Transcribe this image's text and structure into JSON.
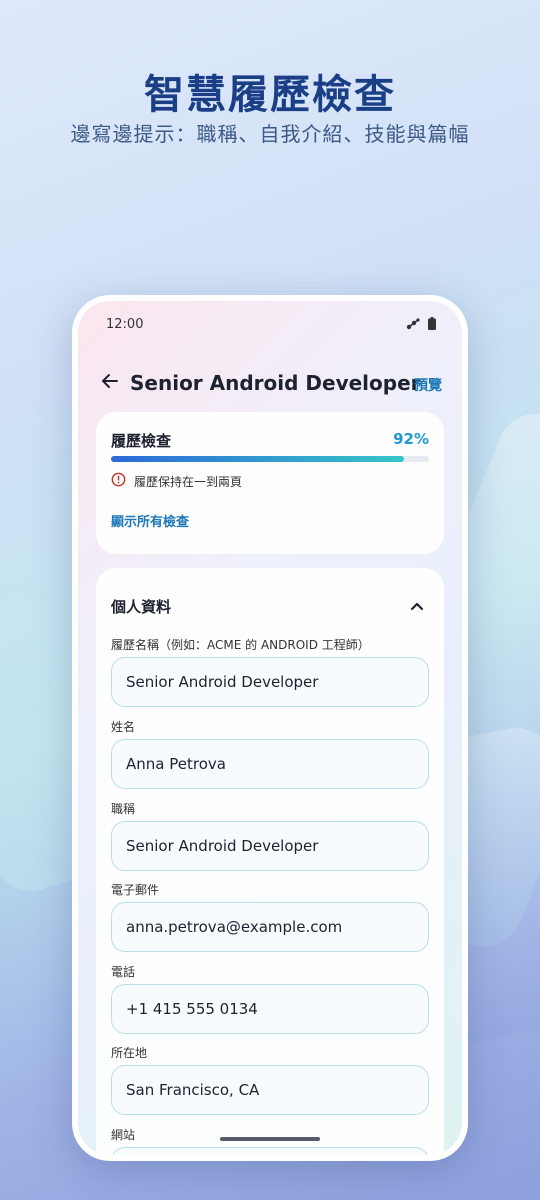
{
  "hero": {
    "title": "智慧履歷檢查",
    "subtitle": "邊寫邊提示：職稱、自我介紹、技能與篇幅"
  },
  "status_bar": {
    "time": "12:00"
  },
  "app_bar": {
    "title": "Senior Android Developer",
    "preview_label": "預覽"
  },
  "resume_check": {
    "title": "履歷檢查",
    "percent_label": "92%",
    "progress": 0.92,
    "warning_text": "履歷保持在一到兩頁",
    "show_all_label": "顯示所有檢查"
  },
  "personal_info": {
    "title": "個人資料",
    "fields": [
      {
        "label": "履歷名稱（例如：ACME 的 ANDROID 工程師）",
        "value": "Senior Android Developer"
      },
      {
        "label": "姓名",
        "value": "Anna Petrova"
      },
      {
        "label": "職稱",
        "value": "Senior Android Developer"
      },
      {
        "label": "電子郵件",
        "value": "anna.petrova@example.com"
      },
      {
        "label": "電話",
        "value": "+1 415 555 0134"
      },
      {
        "label": "所在地",
        "value": "San Francisco, CA"
      },
      {
        "label": "網站",
        "value": ""
      }
    ]
  },
  "colors": {
    "accent": "#1c78b8",
    "percent": "#1c9ad0",
    "warning": "#c0392b",
    "hero_title": "#1b3f86"
  },
  "icons": {
    "back": "arrow-left-icon",
    "collapse": "chevron-up-icon",
    "warning": "alert-circle-icon",
    "battery": "battery-icon",
    "signal": "signal-icon"
  }
}
